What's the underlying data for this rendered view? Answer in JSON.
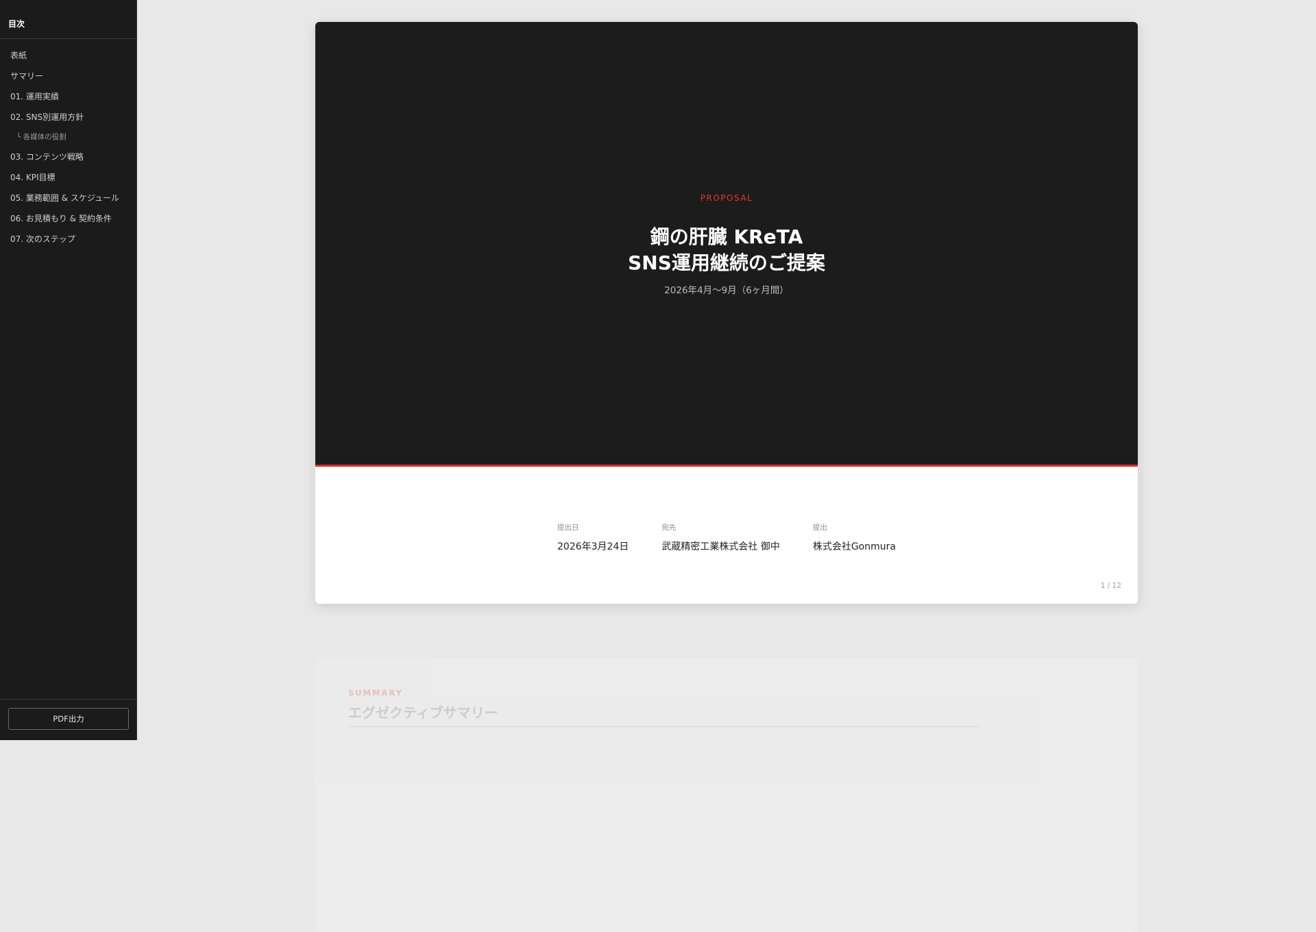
{
  "sidebar": {
    "title": "目次",
    "items": [
      {
        "label": "表紙"
      },
      {
        "label": "サマリー"
      },
      {
        "label": "01. 運用実績"
      },
      {
        "label": "02. SNS別運用方針"
      },
      {
        "label": "└ 各媒体の役割"
      },
      {
        "label": "03. コンテンツ戦略"
      },
      {
        "label": "04. KPI目標"
      },
      {
        "label": "05. 業務範囲 & スケジュール"
      },
      {
        "label": "06. お見積もり & 契約条件"
      },
      {
        "label": "07. 次のステップ"
      }
    ],
    "pdf_button": "PDF出力"
  },
  "slide1": {
    "eyebrow": "PROPOSAL",
    "title_line1": "鋼の肝臓 KReTA",
    "title_line2": "SNS運用継続のご提案",
    "period": "2026年4月〜9月（6ヶ月間）",
    "meta": {
      "date_label": "提出日",
      "date_value": "2026年3月24日",
      "to_label": "宛先",
      "to_value": "武蔵精密工業株式会社 御中",
      "from_label": "提出",
      "from_value": "株式会社Gonmura"
    },
    "page": "1 / 12"
  },
  "slide2": {
    "eyebrow": "SUMMARY",
    "title": "エグゼクティブサマリー"
  },
  "colors": {
    "accent": "#d32f2f",
    "sidebar_bg": "#1b1b1b",
    "cover_bg": "#1c1c1c",
    "page_bg": "#e8e8e8"
  }
}
